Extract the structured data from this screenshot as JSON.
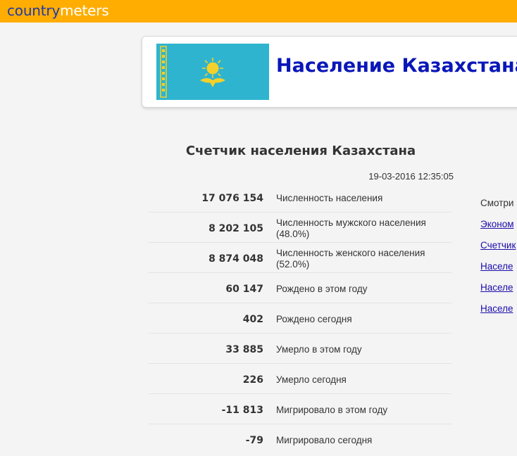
{
  "header": {
    "logo_part1": "country",
    "logo_part2": "meters"
  },
  "title_box": {
    "flag_icon": "kazakhstan-flag-icon",
    "title": "Население Казахстана"
  },
  "counter": {
    "title": "Счетчик населения Казахстана",
    "timestamp": "19-03-2016 12:35:05",
    "rows": [
      {
        "value": "17 076 154",
        "label": "Численность населения"
      },
      {
        "value": "8 202 105",
        "label": "Численность мужского населения (48.0%)"
      },
      {
        "value": "8 874 048",
        "label": "Численность женского населения (52.0%)"
      },
      {
        "value": "60 147",
        "label": "Рождено в этом году"
      },
      {
        "value": "402",
        "label": "Рождено сегодня"
      },
      {
        "value": "33 885",
        "label": "Умерло в этом году"
      },
      {
        "value": "226",
        "label": "Умерло сегодня"
      },
      {
        "value": "-11 813",
        "label": "Мигрировало в этом году"
      },
      {
        "value": "-79",
        "label": "Мигрировало сегодня"
      }
    ]
  },
  "sidebar": {
    "see_text": "Смотри",
    "links": [
      "Эконом",
      "Счетчик",
      "Населе",
      "Населе",
      "Населе"
    ]
  },
  "colors": {
    "topbar": "#ffad00",
    "logo_dark": "#1f3aa8",
    "title_blue": "#0a17b8",
    "flag_blue": "#2fb4cf",
    "flag_gold": "#f4d12a",
    "link": "#1a0dab"
  }
}
